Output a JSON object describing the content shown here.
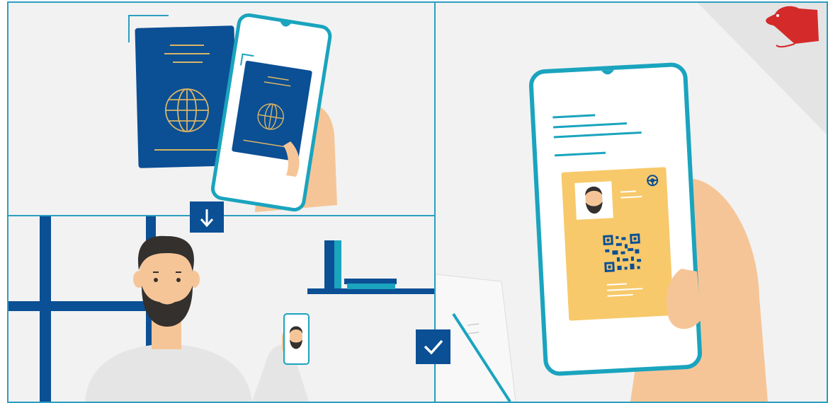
{
  "panels": {
    "scan": "",
    "selfie": "",
    "credential": ""
  },
  "icons": {
    "arrow": "arrow-down-icon",
    "check": "checkmark-icon",
    "brand": "rodent-logo-icon"
  },
  "colors": {
    "border": "#2a9fc1",
    "navy": "#0b4f94",
    "teal": "#1aa4be",
    "gold": "#d9b566",
    "card": "#f7c96a",
    "skin": "#f6c597",
    "beard": "#33302e",
    "logo": "#d42a2a",
    "background": "#f2f2f2"
  }
}
